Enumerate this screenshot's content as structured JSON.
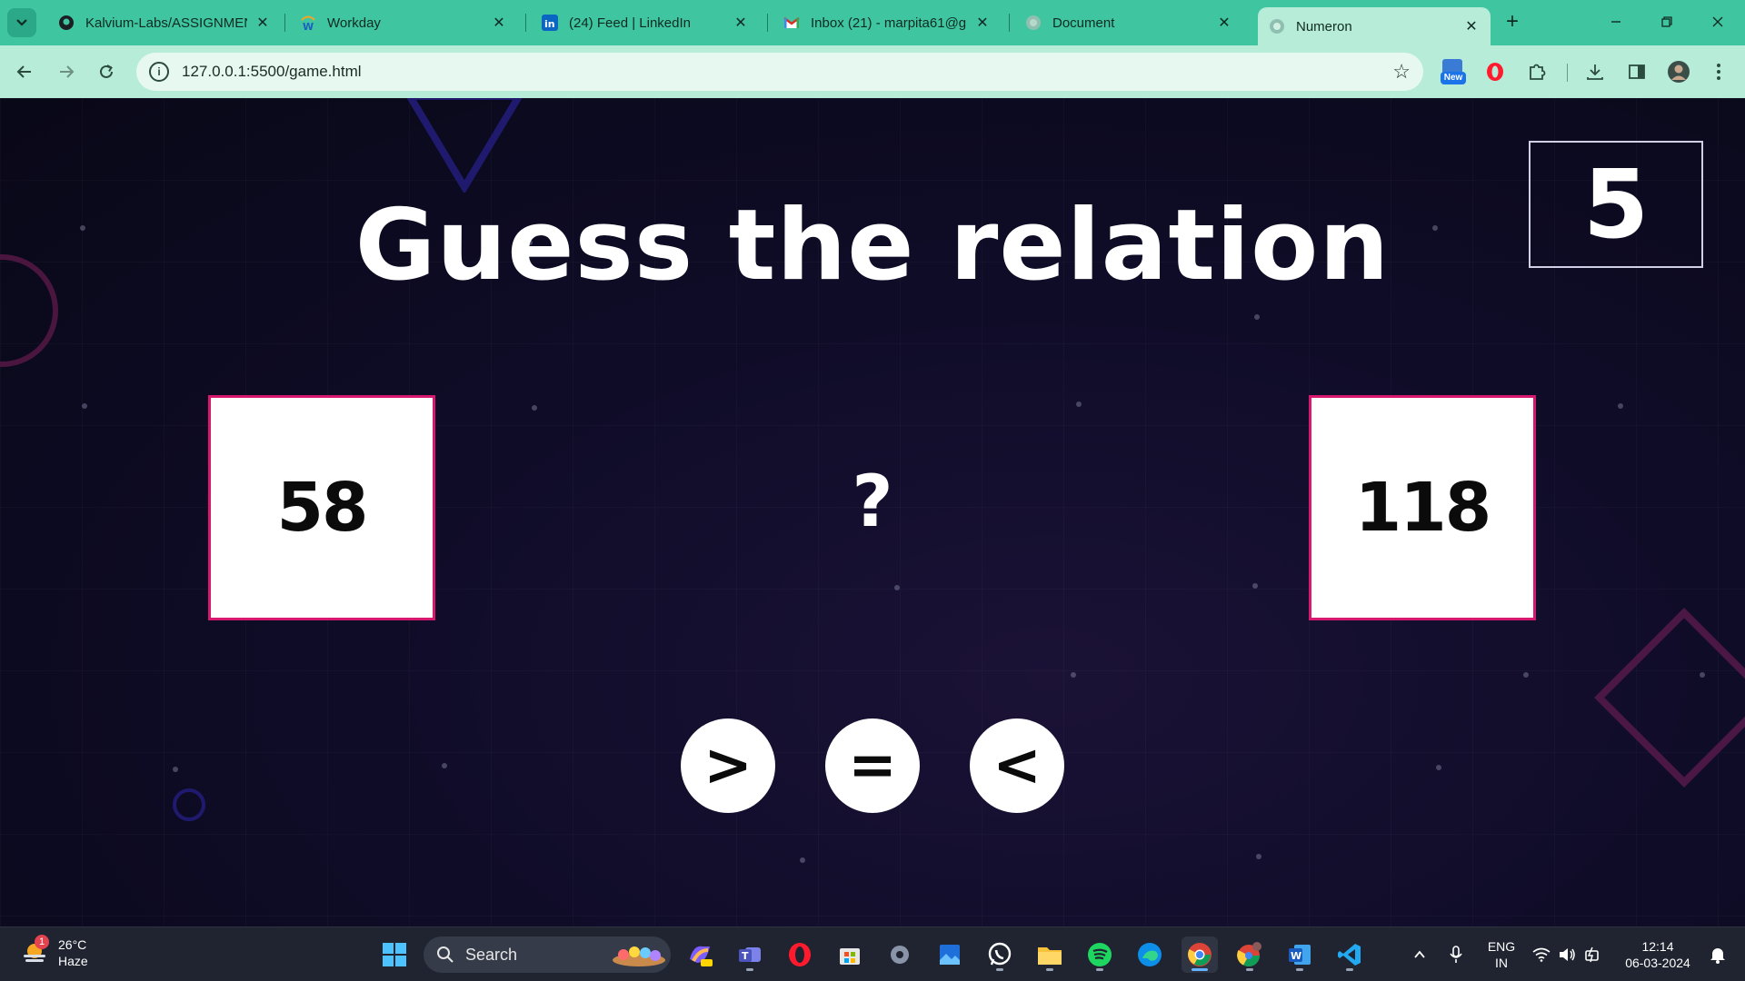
{
  "browser": {
    "tabs": [
      {
        "title": "Kalvium-Labs/ASSIGNMEN",
        "icon": "github-icon"
      },
      {
        "title": "Workday",
        "icon": "workday-icon"
      },
      {
        "title": "(24) Feed | LinkedIn",
        "icon": "linkedin-icon"
      },
      {
        "title": "Inbox (21) - marpita61@g",
        "icon": "gmail-icon"
      },
      {
        "title": "Document",
        "icon": "globe-icon"
      },
      {
        "title": "Numeron",
        "icon": "globe-icon",
        "active": true
      }
    ],
    "url": "127.0.0.1:5500/game.html",
    "extension_badge": "New",
    "accent": "#3fc6a1"
  },
  "game": {
    "title": "Guess the relation",
    "score": "5",
    "left_number": "58",
    "right_number": "118",
    "relation_placeholder": "?",
    "buttons": [
      ">",
      "=",
      "<"
    ],
    "box_border_color": "#d6186e"
  },
  "taskbar": {
    "weather": {
      "temp": "26°C",
      "condition": "Haze",
      "badge": "1"
    },
    "search_label": "Search",
    "language": {
      "line1": "ENG",
      "line2": "IN"
    },
    "time": "12:14",
    "date": "06-03-2024",
    "apps": [
      "copilot-icon",
      "teams-icon",
      "opera-icon",
      "store-icon",
      "settings-icon",
      "photos-icon",
      "whatsapp-icon",
      "explorer-icon",
      "spotify-icon",
      "edge-icon",
      "chrome-icon",
      "chrome-profile-icon",
      "word-icon",
      "vscode-icon"
    ]
  }
}
